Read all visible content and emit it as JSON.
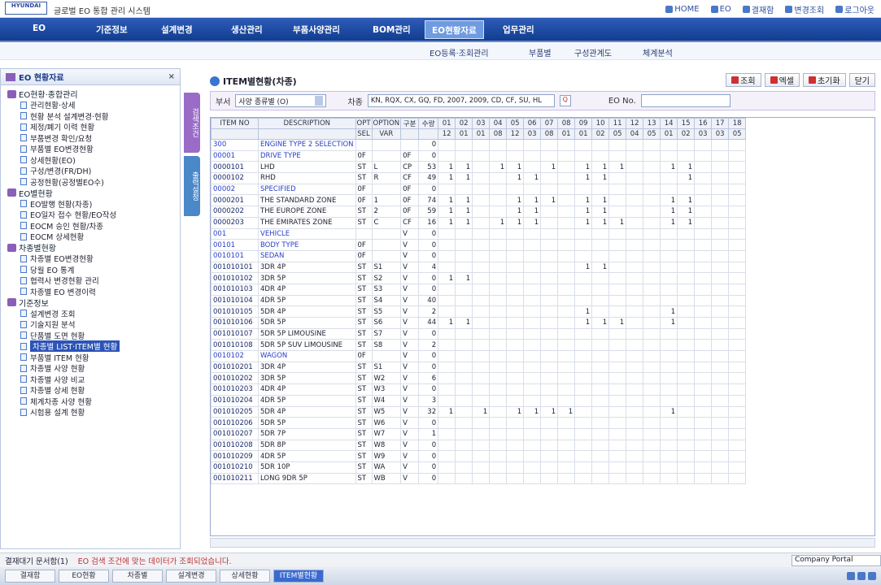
{
  "app": {
    "logo": "HYUNDAI",
    "title": "글로벌 EO 통합 관리 시스템"
  },
  "toplinks": [
    "HOME",
    "EO",
    "결재함",
    "변경조회",
    "로그아웃"
  ],
  "menu": {
    "items": [
      "EO",
      "기준정보",
      "설계변경",
      "생산관리",
      "부품사양관리",
      "BOM관리",
      "EO현황자료",
      "업무관리"
    ],
    "active": "EO현황자료"
  },
  "submenu": [
    "EO등록·조회관리",
    "부품별",
    "구성관계도",
    "체계분석"
  ],
  "left": {
    "title": "EO 현황자료",
    "groups": [
      {
        "name": "EO현황·종합관리",
        "items": [
          "관리현황·상세",
          "현황 분석 설계변경·현황",
          "제정/폐기 이력 현황",
          "부품변경 확인/요청",
          "부품별 EO변경현황",
          "상세현황(EO)",
          "구성/변경(FR/DH)",
          "공정현황(공정별EO수)"
        ]
      },
      {
        "name": "EO별현황",
        "items": [
          "EO발행 현황(차종)",
          "EO일자 접수 현황/EO작성",
          "EOCM 승인 현황/차종",
          "EOCM 상세현황"
        ]
      },
      {
        "name": "차종별현황",
        "items": [
          "차종별 EO변경현황",
          "당월 EO 통계",
          "협력사 변경현황 관리",
          "차종별 EO 변경이력"
        ]
      },
      {
        "name": "기준정보",
        "items": [
          "설계변경 조회",
          "기술지원 분석",
          "단품별 도면 현황",
          "차종별 LIST·ITEM별 현황",
          "부품별 ITEM 현황",
          "차종별 사양 현황",
          "차종별 사양 비교",
          "차종별 상세 현황",
          "체계차종 사양 현황",
          "시험용 설계 현황"
        ]
      }
    ],
    "selected": "차종별 LIST·ITEM별 현황"
  },
  "sidetabs": [
    "검색조건",
    "출력설정"
  ],
  "page": {
    "title": "ITEM별현황(차종)",
    "buttons": [
      "조회",
      "엑셀",
      "초기화",
      "닫기"
    ]
  },
  "filter": {
    "l1": "부서",
    "sel": "사양 종류별 (O)",
    "l2": "차종",
    "inp": "KN, RQX, CX, GQ, FD, 2007, 2009, CD, CF, SU, HL",
    "l3": "EO No."
  },
  "table": {
    "h1": [
      "ITEM NO",
      "DESCRIPTION",
      "OPT",
      "OPTION",
      "구분",
      "수량",
      "01",
      "02",
      "03",
      "04",
      "05",
      "06",
      "07",
      "08",
      "09",
      "10",
      "11",
      "12",
      "13",
      "14",
      "15",
      "16",
      "17",
      "18"
    ],
    "h2": [
      "",
      "",
      "SEL",
      "VAR",
      "",
      "",
      "12",
      "01",
      "01",
      "08",
      "12",
      "03",
      "08",
      "01",
      "01",
      "02",
      "05",
      "04",
      "05",
      "01",
      "02",
      "03",
      "03",
      "05"
    ],
    "rows": [
      {
        "c": "300",
        "d": "ENGINE TYPE 2 SELECTION",
        "o": "",
        "v": "",
        "k": "",
        "q": "0",
        "b": 1,
        "m": []
      },
      {
        "c": "00001",
        "d": "DRIVE TYPE",
        "o": "0F",
        "v": "",
        "k": "0F",
        "q": "0",
        "b": 1,
        "m": []
      },
      {
        "c": "0000101",
        "d": "LHD",
        "o": "ST",
        "v": "L",
        "k": "CP",
        "q": "53",
        "b": 0,
        "m": [
          1,
          1,
          0,
          1,
          1,
          0,
          1,
          0,
          1,
          1,
          1,
          0,
          0,
          1,
          1
        ]
      },
      {
        "c": "0000102",
        "d": "RHD",
        "o": "ST",
        "v": "R",
        "k": "CF",
        "q": "49",
        "b": 0,
        "m": [
          1,
          1,
          0,
          0,
          1,
          1,
          0,
          0,
          1,
          1,
          0,
          0,
          0,
          0,
          1
        ]
      },
      {
        "c": "00002",
        "d": "SPECIFIED",
        "o": "0F",
        "v": "",
        "k": "0F",
        "q": "0",
        "b": 1,
        "m": []
      },
      {
        "c": "0000201",
        "d": "THE STANDARD ZONE",
        "o": "0F",
        "v": "1",
        "k": "0F",
        "q": "74",
        "b": 0,
        "m": [
          1,
          1,
          0,
          0,
          1,
          1,
          1,
          0,
          1,
          1,
          0,
          0,
          0,
          1,
          1
        ]
      },
      {
        "c": "0000202",
        "d": "THE EUROPE ZONE",
        "o": "ST",
        "v": "2",
        "k": "0F",
        "q": "59",
        "b": 0,
        "m": [
          1,
          1,
          0,
          0,
          1,
          1,
          0,
          0,
          1,
          1,
          0,
          0,
          0,
          1,
          1
        ]
      },
      {
        "c": "0000203",
        "d": "THE EMIRATES ZONE",
        "o": "ST",
        "v": "C",
        "k": "CF",
        "q": "16",
        "b": 0,
        "m": [
          1,
          1,
          0,
          1,
          1,
          1,
          0,
          0,
          1,
          1,
          1,
          0,
          0,
          1,
          1
        ]
      },
      {
        "c": "001",
        "d": "VEHICLE",
        "o": "",
        "v": "",
        "k": "V",
        "q": "0",
        "b": 1,
        "m": []
      },
      {
        "c": "00101",
        "d": "BODY TYPE",
        "o": "0F",
        "v": "",
        "k": "V",
        "q": "0",
        "b": 1,
        "m": []
      },
      {
        "c": "0010101",
        "d": "SEDAN",
        "o": "0F",
        "v": "",
        "k": "V",
        "q": "0",
        "b": 1,
        "m": []
      },
      {
        "c": "001010101",
        "d": "3DR 4P",
        "o": "ST",
        "v": "S1",
        "k": "V",
        "q": "4",
        "b": 0,
        "m": [
          0,
          0,
          0,
          0,
          0,
          0,
          0,
          0,
          1,
          1
        ]
      },
      {
        "c": "001010102",
        "d": "3DR 5P",
        "o": "ST",
        "v": "S2",
        "k": "V",
        "q": "0",
        "b": 0,
        "m": [
          1,
          1
        ]
      },
      {
        "c": "001010103",
        "d": "4DR 4P",
        "o": "ST",
        "v": "S3",
        "k": "V",
        "q": "0",
        "b": 0,
        "m": []
      },
      {
        "c": "001010104",
        "d": "4DR 5P",
        "o": "ST",
        "v": "S4",
        "k": "V",
        "q": "40",
        "b": 0,
        "m": []
      },
      {
        "c": "001010105",
        "d": "5DR 4P",
        "o": "ST",
        "v": "S5",
        "k": "V",
        "q": "2",
        "b": 0,
        "m": [
          0,
          0,
          0,
          0,
          0,
          0,
          0,
          0,
          1,
          0,
          0,
          0,
          0,
          1
        ]
      },
      {
        "c": "001010106",
        "d": "5DR 5P",
        "o": "ST",
        "v": "S6",
        "k": "V",
        "q": "44",
        "b": 0,
        "m": [
          1,
          1,
          0,
          0,
          0,
          0,
          0,
          0,
          1,
          1,
          1,
          0,
          0,
          1
        ]
      },
      {
        "c": "001010107",
        "d": "5DR 5P LIMOUSINE",
        "o": "ST",
        "v": "S7",
        "k": "V",
        "q": "0",
        "b": 0,
        "m": []
      },
      {
        "c": "001010108",
        "d": "5DR 5P SUV LIMOUSINE",
        "o": "ST",
        "v": "S8",
        "k": "V",
        "q": "2",
        "b": 0,
        "m": []
      },
      {
        "c": "0010102",
        "d": "WAGON",
        "o": "0F",
        "v": "",
        "k": "V",
        "q": "0",
        "b": 1,
        "m": []
      },
      {
        "c": "001010201",
        "d": "3DR 4P",
        "o": "ST",
        "v": "S1",
        "k": "V",
        "q": "0",
        "b": 0,
        "m": []
      },
      {
        "c": "001010202",
        "d": "3DR 5P",
        "o": "ST",
        "v": "W2",
        "k": "V",
        "q": "6",
        "b": 0,
        "m": []
      },
      {
        "c": "001010203",
        "d": "4DR 4P",
        "o": "ST",
        "v": "W3",
        "k": "V",
        "q": "0",
        "b": 0,
        "m": []
      },
      {
        "c": "001010204",
        "d": "4DR 5P",
        "o": "ST",
        "v": "W4",
        "k": "V",
        "q": "3",
        "b": 0,
        "m": []
      },
      {
        "c": "001010205",
        "d": "5DR 4P",
        "o": "ST",
        "v": "W5",
        "k": "V",
        "q": "32",
        "b": 0,
        "m": [
          1,
          0,
          1,
          0,
          1,
          1,
          1,
          1,
          0,
          0,
          0,
          0,
          0,
          1
        ]
      },
      {
        "c": "001010206",
        "d": "5DR 5P",
        "o": "ST",
        "v": "W6",
        "k": "V",
        "q": "0",
        "b": 0,
        "m": []
      },
      {
        "c": "001010207",
        "d": "5DR 7P",
        "o": "ST",
        "v": "W7",
        "k": "V",
        "q": "1",
        "b": 0,
        "m": []
      },
      {
        "c": "001010208",
        "d": "5DR 8P",
        "o": "ST",
        "v": "W8",
        "k": "V",
        "q": "0",
        "b": 0,
        "m": []
      },
      {
        "c": "001010209",
        "d": "4DR 5P",
        "o": "ST",
        "v": "W9",
        "k": "V",
        "q": "0",
        "b": 0,
        "m": []
      },
      {
        "c": "001010210",
        "d": "5DR 10P",
        "o": "ST",
        "v": "WA",
        "k": "V",
        "q": "0",
        "b": 0,
        "m": []
      },
      {
        "c": "001010211",
        "d": "LONG 9DR 5P",
        "o": "ST",
        "v": "WB",
        "k": "V",
        "q": "0",
        "b": 0,
        "m": []
      }
    ]
  },
  "status": {
    "left": "결재대기 문서함(1)",
    "msg": "EO 검색 조건에 맞는 데이터가 조회되었습니다.",
    "right": "Company Portal"
  },
  "taskbar": [
    "결재함",
    "EO현황",
    "차종별",
    "설계변경",
    "상세현황",
    "ITEM별현황"
  ]
}
